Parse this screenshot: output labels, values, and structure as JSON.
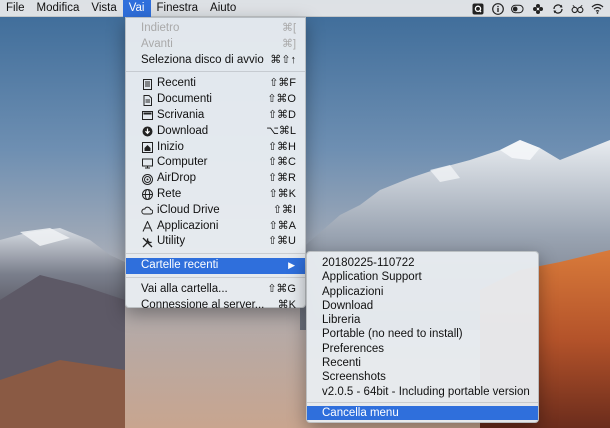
{
  "menubar": {
    "items": [
      {
        "label": "File"
      },
      {
        "label": "Modifica"
      },
      {
        "label": "Vista"
      },
      {
        "label": "Vai"
      },
      {
        "label": "Finestra"
      },
      {
        "label": "Aiuto"
      }
    ],
    "status_icons": [
      "q-app-icon",
      "info-icon",
      "battery-toggle-icon",
      "flower-icon",
      "sync-icon",
      "glasses-icon",
      "wifi-icon"
    ]
  },
  "go_menu": {
    "top": [
      {
        "label": "Indietro",
        "shortcut": "⌘[",
        "disabled": true
      },
      {
        "label": "Avanti",
        "shortcut": "⌘]",
        "disabled": true
      },
      {
        "label": "Seleziona disco di avvio",
        "shortcut": "⌘⇧↑",
        "disabled": false
      }
    ],
    "places": [
      {
        "label": "Recenti",
        "shortcut": "⇧⌘F",
        "icon": "recents-icon"
      },
      {
        "label": "Documenti",
        "shortcut": "⇧⌘O",
        "icon": "documents-icon"
      },
      {
        "label": "Scrivania",
        "shortcut": "⇧⌘D",
        "icon": "desktop-icon"
      },
      {
        "label": "Download",
        "shortcut": "⌥⌘L",
        "icon": "download-icon"
      },
      {
        "label": "Inizio",
        "shortcut": "⇧⌘H",
        "icon": "home-icon"
      },
      {
        "label": "Computer",
        "shortcut": "⇧⌘C",
        "icon": "computer-icon"
      },
      {
        "label": "AirDrop",
        "shortcut": "⇧⌘R",
        "icon": "airdrop-icon"
      },
      {
        "label": "Rete",
        "shortcut": "⇧⌘K",
        "icon": "network-icon"
      },
      {
        "label": "iCloud Drive",
        "shortcut": "⇧⌘I",
        "icon": "icloud-icon"
      },
      {
        "label": "Applicazioni",
        "shortcut": "⇧⌘A",
        "icon": "applications-icon"
      },
      {
        "label": "Utility",
        "shortcut": "⇧⌘U",
        "icon": "utility-icon"
      }
    ],
    "recent_folders": {
      "label": "Cartelle recenti",
      "arrow": "▶"
    },
    "bottom": [
      {
        "label": "Vai alla cartella...",
        "shortcut": "⇧⌘G"
      },
      {
        "label": "Connessione al server...",
        "shortcut": "⌘K"
      }
    ]
  },
  "recent_submenu": {
    "items": [
      "20180225-110722",
      "Application Support",
      "Applicazioni",
      "Download",
      "Libreria",
      "Portable (no need to install)",
      "Preferences",
      "Recenti",
      "Screenshots",
      "v2.0.5 - 64bit - Including portable version"
    ],
    "clear_label": "Cancella menu"
  }
}
